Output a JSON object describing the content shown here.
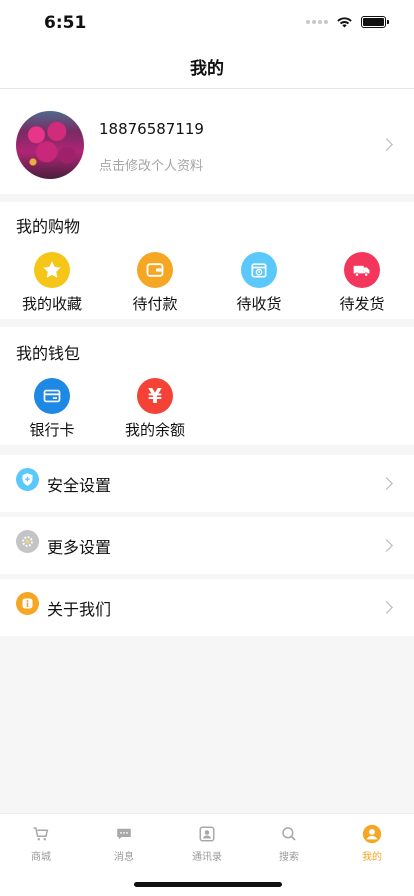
{
  "status": {
    "time": "6:51"
  },
  "nav": {
    "title": "我的"
  },
  "profile": {
    "phone": "18876587119",
    "hint": "点击修改个人资料"
  },
  "shopping": {
    "title": "我的购物",
    "items": [
      {
        "label": "我的收藏",
        "icon": "star-icon",
        "color": "#f5c518"
      },
      {
        "label": "待付款",
        "icon": "wallet-icon",
        "color": "#f5a623"
      },
      {
        "label": "待收货",
        "icon": "clock-package-icon",
        "color": "#5ac8fa"
      },
      {
        "label": "待发货",
        "icon": "truck-icon",
        "color": "#f5365c"
      }
    ]
  },
  "wallet": {
    "title": "我的钱包",
    "items": [
      {
        "label": "银行卡",
        "icon": "card-icon",
        "color": "#1e88e5"
      },
      {
        "label": "我的余额",
        "icon": "yuan-icon",
        "color": "#f44336",
        "glyph": "¥"
      }
    ]
  },
  "settings": [
    {
      "label": "安全设置",
      "icon": "shield-icon",
      "color": "#5ac8fa"
    },
    {
      "label": "更多设置",
      "icon": "gear-icon",
      "color": "#b5b5b5"
    },
    {
      "label": "关于我们",
      "icon": "info-icon",
      "color": "#f5a623"
    }
  ],
  "tabbar": [
    {
      "label": "商城",
      "icon": "cart-icon"
    },
    {
      "label": "消息",
      "icon": "message-icon"
    },
    {
      "label": "通讯录",
      "icon": "contacts-icon"
    },
    {
      "label": "搜索",
      "icon": "search-icon"
    },
    {
      "label": "我的",
      "icon": "user-icon",
      "active": true
    }
  ]
}
